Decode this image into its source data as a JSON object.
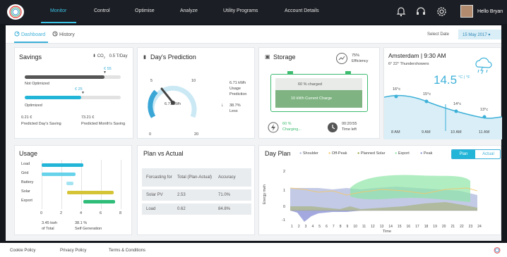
{
  "nav": [
    "Monitor",
    "Control",
    "Optimise",
    "Analyze",
    "Utility Programs",
    "Account Details"
  ],
  "user_name": "Hello Bryan",
  "tabs": [
    "Dashboard",
    "History"
  ],
  "select_date_label": "Select Date",
  "select_date_value": "15 May 2017",
  "savings": {
    "title": "Savings",
    "co2_label": "CO",
    "co2_value": "0.5 T/Day",
    "marker1": "€ 55",
    "not_optimized": "Not Optimized",
    "marker2": "€ 25",
    "optimized": "Optimized",
    "day_value": "0.21 €",
    "day_label": "Predicted Day's Saving",
    "month_value": "73.21 €",
    "month_label": "Predicted Month's Saving",
    "not_optimized_fill": 0.83,
    "optimized_fill": 0.59
  },
  "prediction": {
    "title": "Day's Prediction",
    "gauge_min": "0",
    "gauge_5": "5",
    "gauge_10": "10",
    "gauge_max": "20",
    "gauge_value": "6.71 kWh",
    "usage_value": "6.71 kWh",
    "usage_label1": "Usage",
    "usage_label2": "Prediction",
    "less_value": "38.7%",
    "less_label": "Less"
  },
  "storage": {
    "title": "Storage",
    "efficiency_value": "75%",
    "efficiency_label": "Efficiency",
    "charged": "60 % charged",
    "current": "10 kWh Current Charge",
    "charging_pct": "60 %",
    "charging_label": "Charging...",
    "time_value": "00:20:55",
    "time_label": "Time left",
    "charge_fraction": 0.6
  },
  "weather": {
    "city_time": "Amsterdam | 9:30 AM",
    "details": "6°   22°   Thundershowers",
    "temp": "14.5",
    "unit_c": "°C",
    "unit_f": "°F",
    "points": [
      {
        "time": "8 AM",
        "temp": "16°c"
      },
      {
        "time": "9 AM",
        "temp": "15°c"
      },
      {
        "time": "10 AM",
        "temp": "14°c"
      },
      {
        "time": "11 AM",
        "temp": "13°c"
      }
    ]
  },
  "usage": {
    "title": "Usage",
    "rows": [
      {
        "label": "Load",
        "start": 0,
        "end": 4.2,
        "color": "#22b5d8"
      },
      {
        "label": "Grid",
        "start": 0,
        "end": 3.4,
        "color": "#67d3ea"
      },
      {
        "label": "Battery",
        "start": 2.5,
        "end": 3.2,
        "color": "#a4e4f2"
      },
      {
        "label": "Solar",
        "start": 2.6,
        "end": 7.3,
        "color": "#d6c437"
      },
      {
        "label": "Export",
        "start": 4.2,
        "end": 7.4,
        "color": "#2fbd79"
      }
    ],
    "axis": [
      "0",
      "2",
      "4",
      "6",
      "8"
    ],
    "total_value": "3.45 kwh",
    "total_label": "of Total",
    "self_value": "38.1 %",
    "self_label": "Self Generation"
  },
  "plan_actual": {
    "title": "Plan vs Actual",
    "headers": [
      "Forcasting for",
      "Total (Plan-Actual)",
      "Accuracy"
    ],
    "rows": [
      [
        "Solar PV",
        "2.53",
        "71.0%"
      ],
      [
        "Load",
        "0.62",
        "84.8%"
      ]
    ]
  },
  "day_plan": {
    "title": "Day Plan",
    "legend": [
      {
        "name": "Shoulder",
        "color": "#aab4dc"
      },
      {
        "name": "Off-Peak",
        "color": "#f2c86b"
      },
      {
        "name": "Planned Solar",
        "color": "#9aa74a"
      },
      {
        "name": "Export",
        "color": "#8fe6a6"
      },
      {
        "name": "Peak",
        "color": "#8c93d6"
      }
    ],
    "toggle": [
      "Plan",
      "Actual"
    ],
    "ylabel": "Energy mwh",
    "xlabel": "Time",
    "yticks": [
      "2",
      "1",
      "0",
      "-1"
    ],
    "xticks": [
      "1",
      "2",
      "3",
      "4",
      "5",
      "6",
      "7",
      "8",
      "9",
      "10",
      "11",
      "12",
      "13",
      "14",
      "15",
      "16",
      "17",
      "18",
      "19",
      "20",
      "21",
      "22",
      "23",
      "24"
    ]
  },
  "footer": [
    "Cookie Policy",
    "Privacy Policy",
    "Terms & Conditions"
  ]
}
